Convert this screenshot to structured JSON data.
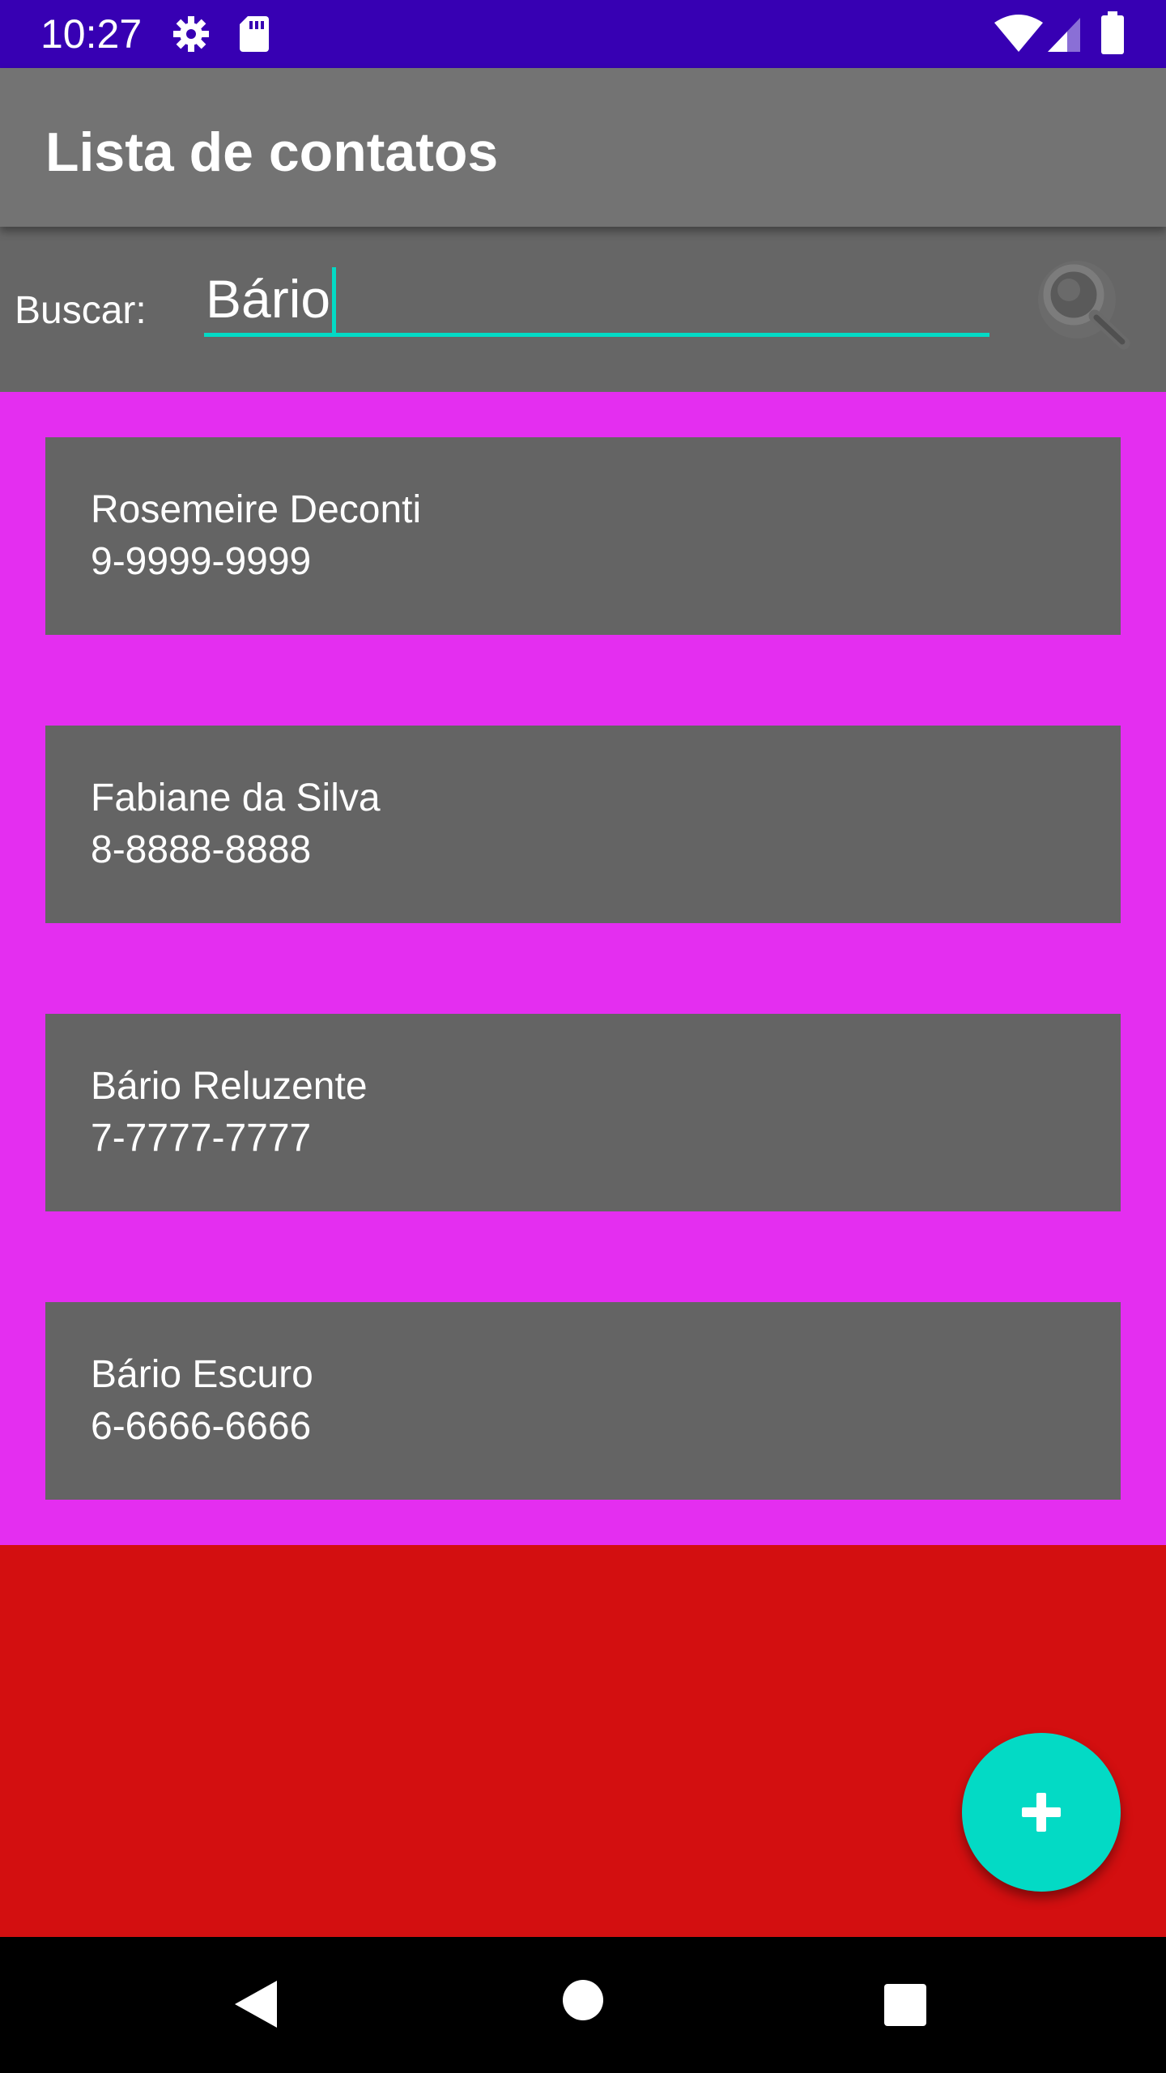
{
  "status_bar": {
    "time": "10:27",
    "background": "#3700b3",
    "icons": [
      "gear-icon",
      "sd-card-icon",
      "wifi-icon",
      "signal-icon",
      "battery-icon"
    ]
  },
  "app_bar": {
    "title": "Lista de contatos",
    "background": "#737373"
  },
  "search": {
    "label": "Buscar:",
    "value": "Bário",
    "accent": "#03dac5",
    "button_icon": "search-icon"
  },
  "contacts": [
    {
      "name": "Rosemeire Deconti",
      "phone": "9-9999-9999"
    },
    {
      "name": "Fabiane da Silva",
      "phone": "8-8888-8888"
    },
    {
      "name": "Bário Reluzente",
      "phone": "7-7777-7777"
    },
    {
      "name": "Bário Escuro",
      "phone": "6-6666-6666"
    }
  ],
  "colors": {
    "list_background": "#e42ef0",
    "card_background": "#646464",
    "page_background": "#d30f10",
    "fab": "#03dac5"
  },
  "fab": {
    "icon": "plus-icon"
  },
  "nav_bar": {
    "icons": [
      "back-icon",
      "home-icon",
      "recents-icon"
    ]
  }
}
